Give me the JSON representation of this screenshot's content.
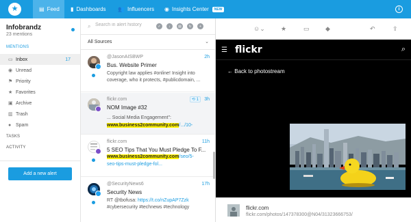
{
  "nav": {
    "logo_icon": "star-icon",
    "items": [
      {
        "label": "Feed",
        "icon": "feed-icon"
      },
      {
        "label": "Dashboards",
        "icon": "bar-chart-icon"
      },
      {
        "label": "Influencers",
        "icon": "users-icon"
      },
      {
        "label": "Insights Center",
        "icon": "compass-icon",
        "badge": "NEW"
      }
    ],
    "info_icon": "info-icon"
  },
  "sidebar": {
    "brand": "Infobrandz",
    "mentions_count": "23 mentions",
    "mentions_heading": "MENTIONS",
    "items": [
      {
        "label": "Inbox",
        "count": "17",
        "icon": "inbox-icon"
      },
      {
        "label": "Unread",
        "icon": "eye-icon"
      },
      {
        "label": "Priority",
        "icon": "flag-icon"
      },
      {
        "label": "Favorites",
        "icon": "star-icon"
      },
      {
        "label": "Archive",
        "icon": "archive-icon"
      },
      {
        "label": "Trash",
        "icon": "trash-icon"
      },
      {
        "label": "Spam",
        "icon": "spam-icon"
      }
    ],
    "tasks_heading": "TASKS",
    "activity_heading": "ACTIVITY",
    "add_alert": "Add a new alert"
  },
  "middle": {
    "search_placeholder": "Search in alert history",
    "sources_label": "All Sources",
    "items": [
      {
        "author": "@JasonAISBWP",
        "time": "2h",
        "title": "Bus. Website Primer",
        "line1": "Copyright law applies #online! Insight into",
        "line2": "coverage, who it protects, #publicdomain, ..."
      },
      {
        "author": "flickr.com",
        "time": "3h",
        "badge": "1",
        "title": "NOM Image #32",
        "line1": "... Social Media Engagement\":",
        "line2_hl": "www.business2community.com",
        "line2_rest": "/.../10-"
      },
      {
        "author": "flickr.com",
        "time": "11h",
        "title": "5 SEO Tips That You Must Pledge To F...",
        "line1_hl": "www.business2community.com",
        "line1_rest": "/seo/5-",
        "line2": "seo-tips-must-pledge-fol..."
      },
      {
        "author": "@SecurityNews6",
        "time": "17h",
        "title": "Security News",
        "line1_pre": "RT @tbofusa: ",
        "line1_link": "https://t.co/nZupAP7Zzk",
        "line2": "#cybersecurity #technews #technology"
      }
    ]
  },
  "preview": {
    "site_logo": "flickr",
    "back_label": "Back to photostream",
    "site_name": "flickr.com",
    "url": "flickr.com/photos/147378300@N04/31323666753/"
  }
}
